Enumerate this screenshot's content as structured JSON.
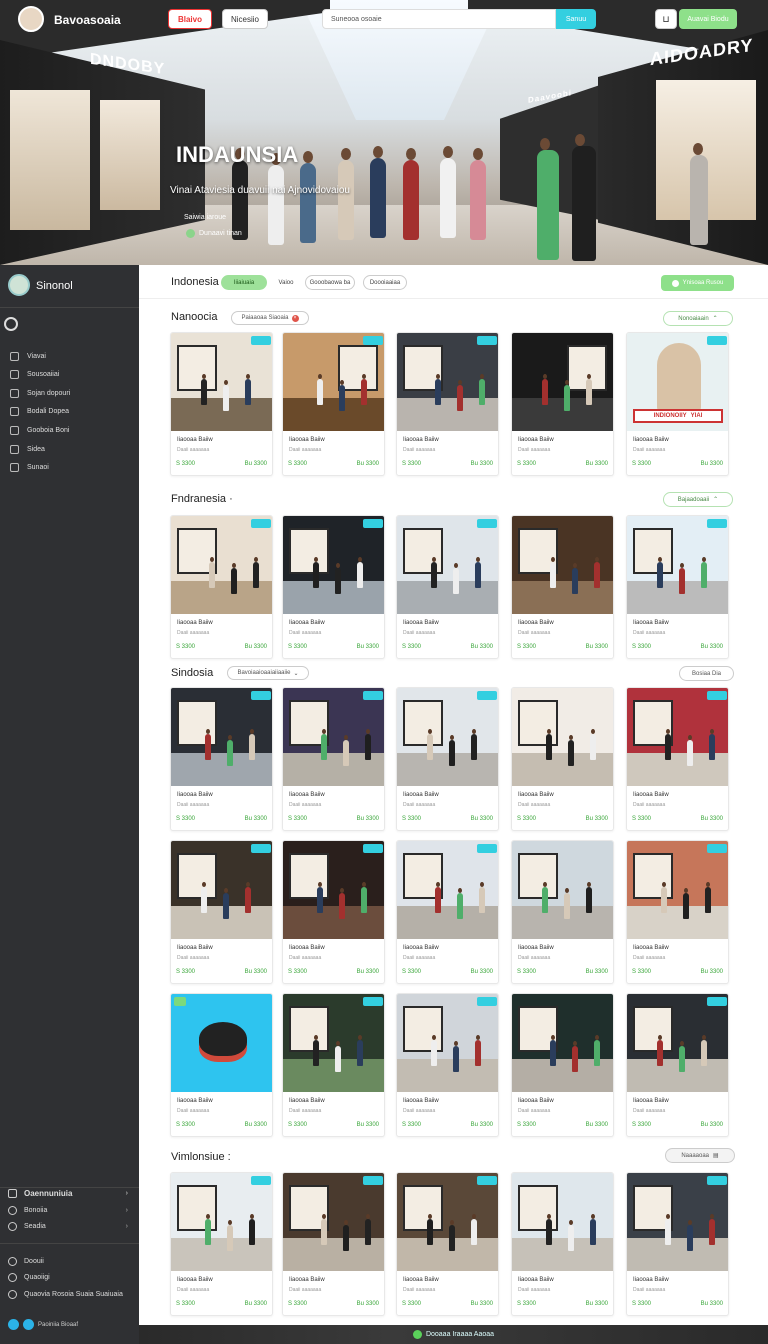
{
  "header": {
    "brand": "Bavoasoaia",
    "button_a": "Blaivo",
    "button_b": "Nicesiio",
    "search_placeholder": "Suneooa osoaie",
    "search_button": "Sanuu",
    "cart_icon": "cart-icon",
    "cta": "Auavai Biodu"
  },
  "hero": {
    "title": "INDAUNSIA",
    "subtitle": "Vinai Ataviesia duavuii nai Ajnovidovaiou",
    "meta1": "Saiwia iaroue",
    "meta2": "Dunaavi tinan",
    "sign_left": "DNDOBY",
    "sign_right": "AIDOADRY",
    "sign_mid": "Daavoobi"
  },
  "sidebar": {
    "user": "Sinonol",
    "items": [
      "Viavai",
      "Sousoaiiai",
      "Sojan dopouri",
      "Bodali Dopea",
      "Gooboia Boni",
      "Sidea",
      "Sunaoi"
    ],
    "footer": [
      {
        "label": "Oaennuniuia"
      },
      {
        "label": "Bonoiia"
      },
      {
        "label": "Seadia"
      }
    ],
    "extra": [
      "Doouii",
      "Quaoiigi",
      "Quaovia Rosoia Suaia Suaiuaia"
    ],
    "share": "Paoiniia Bioaaf"
  },
  "main": {
    "title": "Indonesia",
    "pills": [
      "Iiiaiuaia",
      "Vaioo",
      "Gooobaowa ba",
      "Doooiaaiaa"
    ],
    "cta": "Ynisoaa Rusou"
  },
  "sections": [
    {
      "title": "Nanoocia",
      "chip": "Paiaaoaa Siaoaia",
      "button": "Nonoaiaain"
    },
    {
      "title": "Fndranesia",
      "button": "Bajaadoaaii"
    },
    {
      "title": "Sindosia",
      "chip": "Bavoiaaioaaiaiiaaiie",
      "button": "Bosiaa Dia"
    },
    {
      "title": "Vimlonsiue",
      "button": "Naaaaoaa"
    }
  ],
  "card": {
    "title": "Iiaooaa Baiiw",
    "sub": "Daaii aaaaaaa",
    "price": "S 3300",
    "price2": "Bu 3300",
    "promo_left": "INDIONOIIY",
    "promo_right": "YIAI"
  },
  "footer_strip": "Dooaaa Iraaaa Aaoaa",
  "colors": {
    "accent_green": "#8ee08a",
    "accent_cyan": "#33cfe0",
    "sidebar": "#2f3033",
    "alert_red": "#e33"
  }
}
